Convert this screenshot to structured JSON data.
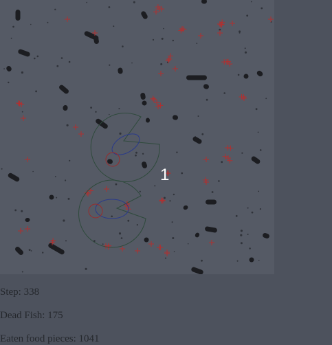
{
  "simulation": {
    "fish_label": "1",
    "colors": {
      "background": "#555a65",
      "page": "#4d525d",
      "poison": "#1c1d21",
      "food": "#b03030",
      "vision": "#2f4a3c",
      "sense": "#2a3a8a",
      "mouth": "#9a2a2a"
    }
  },
  "stats": {
    "step": "Step: 338",
    "dead_fish": "Dead Fish: 175",
    "eaten_food": "Eaten food pieces: 1041"
  }
}
